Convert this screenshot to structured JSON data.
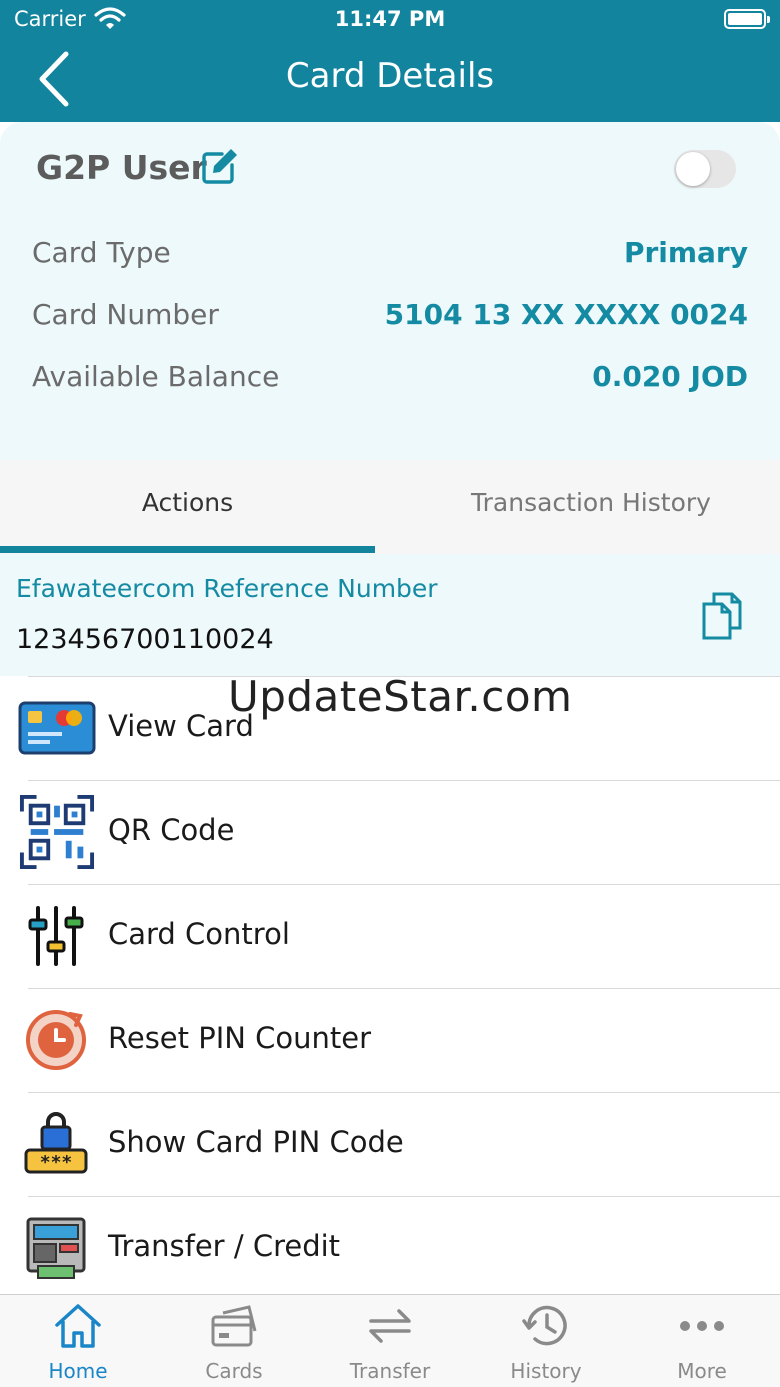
{
  "status_bar": {
    "carrier": "Carrier",
    "time": "11:47 PM"
  },
  "nav": {
    "title": "Card Details"
  },
  "card": {
    "user_name": "G2P User",
    "rows": [
      {
        "label": "Card Type",
        "value": "Primary"
      },
      {
        "label": "Card Number",
        "value": "5104 13 XX XXXX 0024"
      },
      {
        "label": "Available Balance",
        "value": "0.020 JOD"
      }
    ]
  },
  "tabs": [
    {
      "label": "Actions",
      "active": true
    },
    {
      "label": "Transaction History",
      "active": false
    }
  ],
  "reference": {
    "label": "Efawateercom Reference Number",
    "value": "123456700110024"
  },
  "watermark": "UpdateStar.com",
  "actions": [
    {
      "label": "View Card",
      "icon": "credit-card-icon"
    },
    {
      "label": "QR Code",
      "icon": "qr-code-icon"
    },
    {
      "label": "Card Control",
      "icon": "sliders-icon"
    },
    {
      "label": "Reset PIN Counter",
      "icon": "reset-counter-icon"
    },
    {
      "label": "Show Card PIN Code",
      "icon": "pin-lock-icon"
    },
    {
      "label": "Transfer / Credit",
      "icon": "atm-machine-icon"
    }
  ],
  "tabbar": [
    {
      "label": "Home",
      "icon": "home-icon",
      "active": true
    },
    {
      "label": "Cards",
      "icon": "cards-icon",
      "active": false
    },
    {
      "label": "Transfer",
      "icon": "transfer-arrows-icon",
      "active": false
    },
    {
      "label": "History",
      "icon": "history-clock-icon",
      "active": false
    },
    {
      "label": "More",
      "icon": "more-dots-icon",
      "active": false
    }
  ],
  "colors": {
    "primary": "#12849d",
    "accent_text": "#148aa3",
    "panel_bg": "#eef9fb",
    "tab_active": "#1a86c8"
  }
}
